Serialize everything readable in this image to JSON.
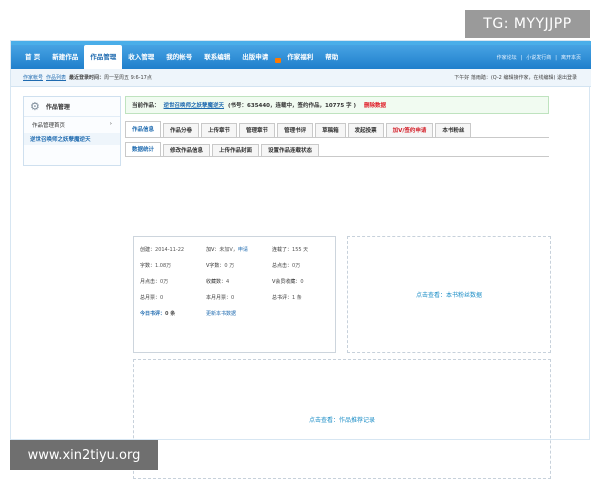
{
  "watermarks": {
    "top": "TG: MYYJJPP",
    "bottom": "www.xin2tiyu.org"
  },
  "nav": {
    "items": [
      "首 页",
      "新建作品",
      "作品管理",
      "收入管理",
      "我的帐号",
      "联系编辑",
      "出版申请",
      "作家福利",
      "帮助"
    ],
    "active_index": 2,
    "badge_index": 6,
    "right_links": [
      "作家论坛",
      "|",
      "小说发行商",
      "|",
      "离开本页"
    ]
  },
  "subbar": {
    "links": [
      "作家帐号",
      "作品列表"
    ],
    "last_login_label": "最近登录时间：",
    "last_login_value": "周一至周五 9:6-17点",
    "right_text": "下午好 落雨踏：(Q-2 编辑接作家，在线编辑) 退出登录"
  },
  "sidebar": {
    "title": "作品管理",
    "link": "作品管理首页",
    "link_arrow": "›",
    "book_link": "逆世召唤师之妖孽魔逆天"
  },
  "info_bar": {
    "label": "当前作品：",
    "book": "逆世召唤师之妖孽魔逆天",
    "status": "(书号：635440，连载中，签约作品，10775 字 )",
    "action": "删除数据"
  },
  "tabs": [
    "作品信息",
    "作品分卷",
    "上传章节",
    "管理章节",
    "管理书评",
    "草稿箱",
    "发起投票",
    "加V/签约申请",
    "本书粉丝"
  ],
  "tabs_active": 0,
  "tabs_red": 7,
  "subtabs": [
    "数据统计",
    "修改作品信息",
    "上传作品封面",
    "设置作品连载状态"
  ],
  "subtabs_active": 0,
  "stats": [
    {
      "label": "创建：",
      "value": "2014-11-22"
    },
    {
      "label": "加V：",
      "value": "未加V，",
      "link": "申请"
    },
    {
      "label": "连载了：",
      "value": "155 天"
    },
    {
      "label": "字数：",
      "value": "1.08万"
    },
    {
      "label": "V字数：",
      "value": "0 万"
    },
    {
      "label": "总点击：",
      "value": "0万"
    },
    {
      "label": "月点击：",
      "value": "0万"
    },
    {
      "label": "收藏数：",
      "value": "4"
    },
    {
      "label": "V会员收藏：",
      "value": "0"
    },
    {
      "label": "总月票：",
      "value": "0"
    },
    {
      "label": "本月月票：",
      "value": "0"
    },
    {
      "label": "总书评：",
      "value": "1 条"
    },
    {
      "label": "今日书评：",
      "value": "0 条"
    },
    {
      "label": "",
      "value": "",
      "link": "更新本书数据"
    }
  ],
  "fans_box": "点击查看：本书粉丝数据",
  "records_box": "点击查看：作品推荐记录"
}
